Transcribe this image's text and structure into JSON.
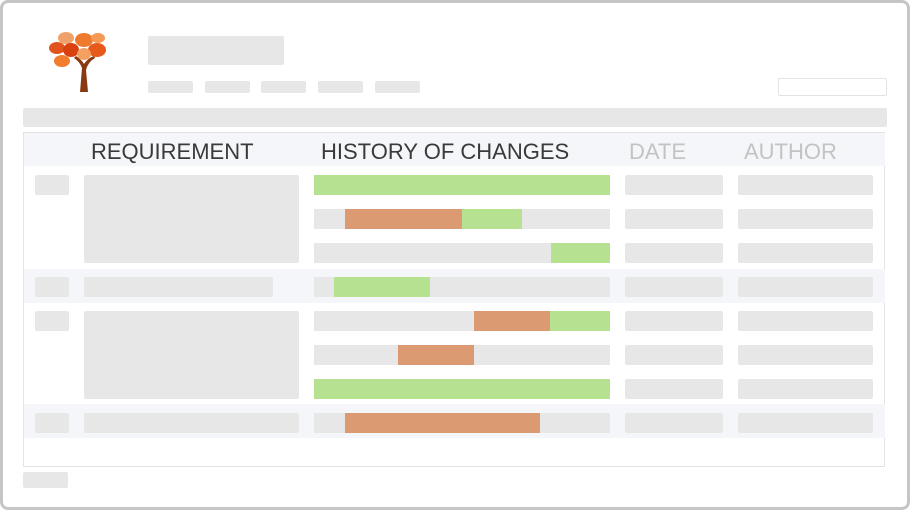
{
  "colors": {
    "placeholder": "#e7e7e7",
    "added": "#b6e190",
    "removed": "#db9a72",
    "header_active_text": "#3a3a3a",
    "header_muted_text": "#c3c3c3"
  },
  "logo": {
    "icon": "tree-logo"
  },
  "table": {
    "columns": [
      {
        "label": "REQUIREMENT",
        "muted": false
      },
      {
        "label": "HISTORY OF CHANGES",
        "muted": false
      },
      {
        "label": "DATE",
        "muted": true
      },
      {
        "label": "AUTHOR",
        "muted": true
      }
    ]
  }
}
